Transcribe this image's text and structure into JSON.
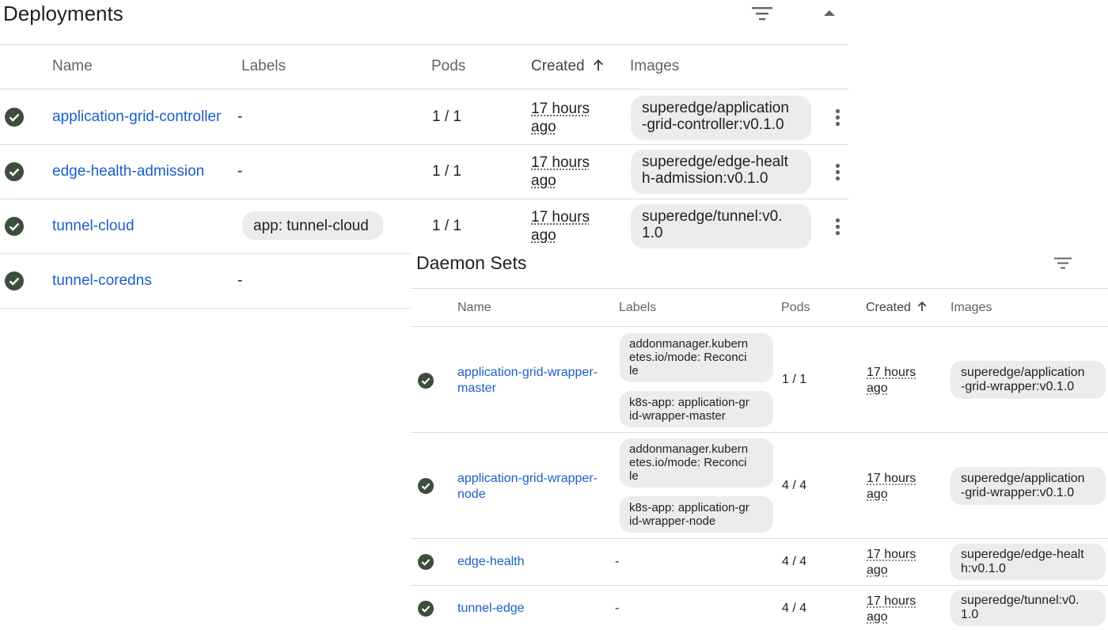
{
  "deployments": {
    "title": "Deployments",
    "columns": {
      "name": "Name",
      "labels": "Labels",
      "pods": "Pods",
      "created": "Created",
      "images": "Images"
    },
    "rows": [
      {
        "name": "application-grid-controller",
        "labels": "-",
        "pods": "1 / 1",
        "created1": "17 hours",
        "created2": "ago",
        "image1": "superedge/application",
        "image2": "-grid-controller:v0.1.0"
      },
      {
        "name": "edge-health-admission",
        "labels": "-",
        "pods": "1 / 1",
        "created1": "17 hours",
        "created2": "ago",
        "image1": "superedge/edge-healt",
        "image2": "h-admission:v0.1.0"
      },
      {
        "name": "tunnel-cloud",
        "labels": "app: tunnel-cloud",
        "pods": "1 / 1",
        "created1": "17 hours",
        "created2": "ago",
        "image1": "superedge/tunnel:v0.",
        "image2": "1.0"
      },
      {
        "name": "tunnel-coredns",
        "labels": "-"
      }
    ]
  },
  "daemon_sets": {
    "title": "Daemon Sets",
    "columns": {
      "name": "Name",
      "labels": "Labels",
      "pods": "Pods",
      "created": "Created",
      "images": "Images"
    },
    "rows": [
      {
        "name1": "application-grid-wrapper-",
        "name2": "master",
        "label_a1": "addonmanager.kubern",
        "label_a2": "etes.io/mode: Reconci",
        "label_a3": "le",
        "label_b1": "k8s-app: application-gr",
        "label_b2": "id-wrapper-master",
        "pods": "1 / 1",
        "created1": "17 hours",
        "created2": "ago",
        "image1": "superedge/application",
        "image2": "-grid-wrapper:v0.1.0"
      },
      {
        "name1": "application-grid-wrapper-",
        "name2": "node",
        "label_a1": "addonmanager.kubern",
        "label_a2": "etes.io/mode: Reconci",
        "label_a3": "le",
        "label_b1": "k8s-app: application-gr",
        "label_b2": "id-wrapper-node",
        "pods": "4 / 4",
        "created1": "17 hours",
        "created2": "ago",
        "image1": "superedge/application",
        "image2": "-grid-wrapper:v0.1.0"
      },
      {
        "name": "edge-health",
        "labels": "-",
        "pods": "4 / 4",
        "created1": "17 hours",
        "created2": "ago",
        "image1": "superedge/edge-healt",
        "image2": "h:v0.1.0"
      },
      {
        "name": "tunnel-edge",
        "labels": "-",
        "pods": "4 / 4",
        "created1": "17 hours",
        "created2": "ago",
        "image1": "superedge/tunnel:v0.",
        "image2": "1.0"
      }
    ]
  },
  "icons": {
    "status": "check-circle-icon",
    "filter": "filter-icon",
    "collapse": "chevron-up-icon",
    "menu": "more-vert-icon",
    "sort": "arrow-upward-icon"
  },
  "colors": {
    "link": "#1a5fc9",
    "status": "#3c4f3c",
    "chip": "#ececec",
    "divider": "#dcdcdc"
  }
}
